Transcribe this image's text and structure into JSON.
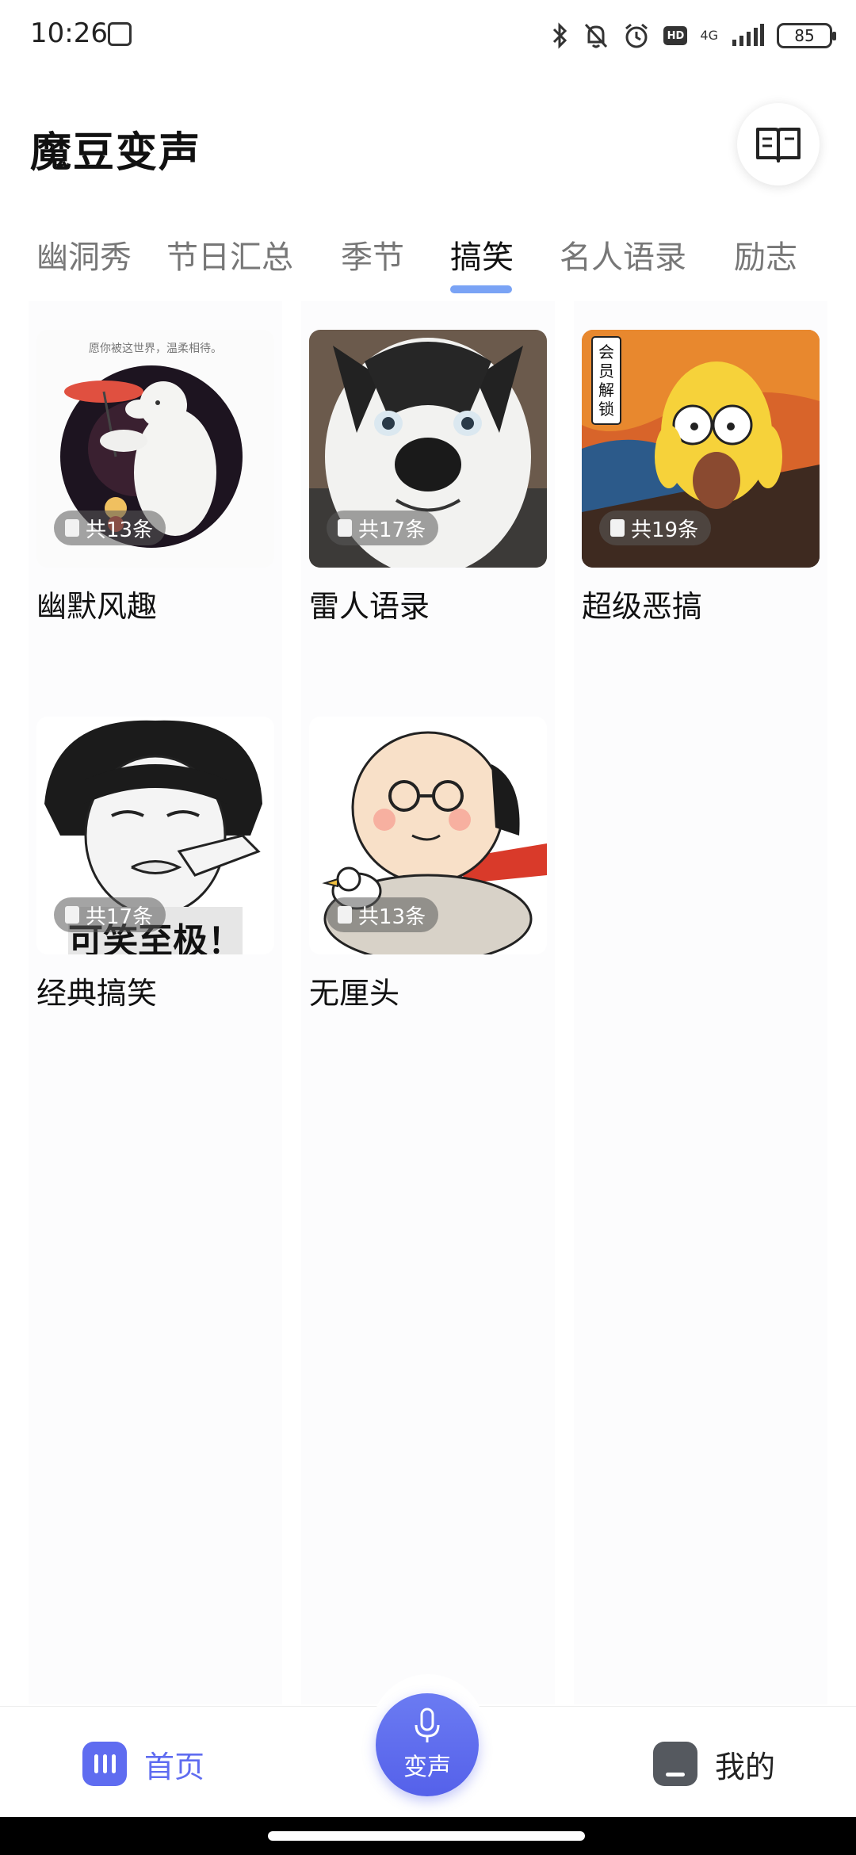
{
  "status_bar": {
    "time": "10:26",
    "network": "4G",
    "hd": "HD",
    "battery": "85",
    "icons": [
      "bluetooth-icon",
      "mute-icon",
      "alarm-icon",
      "hd-icon",
      "signal-icon",
      "battery-icon"
    ]
  },
  "header": {
    "title": "魔豆变声",
    "book_icon": "book-icon"
  },
  "tabs": [
    {
      "label": "幽洞秀"
    },
    {
      "label": "节日汇总"
    },
    {
      "label": "季节"
    },
    {
      "label": "搞笑",
      "active": true
    },
    {
      "label": "名人语录"
    },
    {
      "label": "励志"
    }
  ],
  "cards": [
    {
      "title": "幽默风趣",
      "count": "共13条"
    },
    {
      "title": "雷人语录",
      "count": "共17条"
    },
    {
      "title": "超级恶搞",
      "count": "共19条",
      "vip_badge": "会员解锁"
    },
    {
      "title": "经典搞笑",
      "count": "共17条",
      "overlay_text": "可笑至极！"
    },
    {
      "title": "无厘头",
      "count": "共13条"
    }
  ],
  "bottom_nav": {
    "home": "首页",
    "voice": "变声",
    "mine": "我的"
  },
  "colors": {
    "accent": "#5f6cf0",
    "tab_indicator": "#7aa3f5"
  }
}
